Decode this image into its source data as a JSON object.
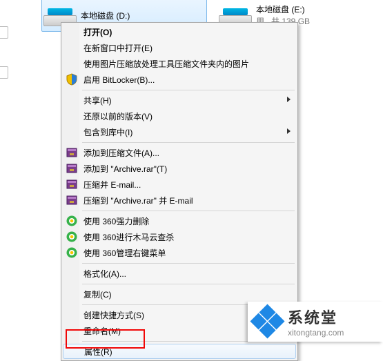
{
  "drives": {
    "d": {
      "label": "本地磁盘 (D:)"
    },
    "e": {
      "label": "本地磁盘 (E:)",
      "sub": "用 , 共 139 GB"
    }
  },
  "menu": {
    "open": "打开(O)",
    "newwin": "在新窗口中打开(E)",
    "imgcompress": "使用图片压缩放处理工具压缩文件夹内的图片",
    "bitlocker": "启用 BitLocker(B)...",
    "share": "共享(H)",
    "prevver": "还原以前的版本(V)",
    "include": "包含到库中(I)",
    "addarchiveA": "添加到压缩文件(A)...",
    "addarchiveT": "添加到 \"Archive.rar\"(T)",
    "emailzip": "压缩并 E-mail...",
    "emailrar": "压缩到 \"Archive.rar\" 并 E-mail",
    "del360": "使用 360强力删除",
    "scan360": "使用 360进行木马云查杀",
    "mgr360": "使用 360管理右键菜单",
    "format": "格式化(A)...",
    "copy": "复制(C)",
    "shortcut": "创建快捷方式(S)",
    "rename": "重命名(M)",
    "properties": "属性(R)"
  },
  "watermark": {
    "cn": "系统堂",
    "en": "xitongtang.com"
  }
}
